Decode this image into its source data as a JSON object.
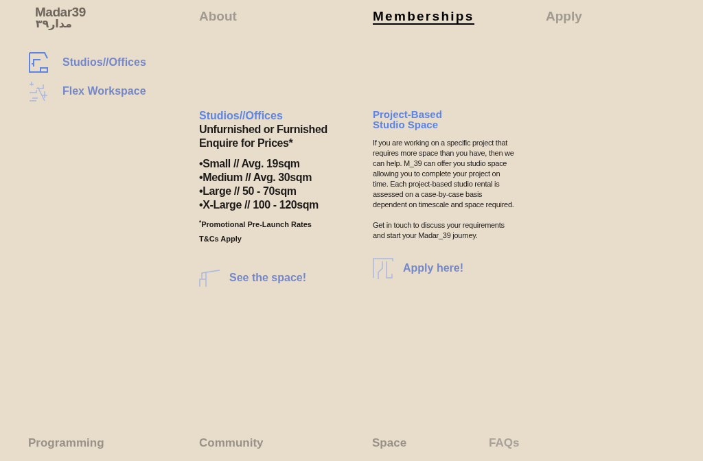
{
  "logo": {
    "latin": "Madar39",
    "arabic": "مدار٣٩"
  },
  "nav": [
    {
      "label": "About",
      "selected": false
    },
    {
      "label": "Memberships",
      "selected": true
    },
    {
      "label": "Apply",
      "selected": false
    }
  ],
  "sidebar": {
    "items": [
      {
        "label": "Studios//Offices",
        "selected": true
      },
      {
        "label": "Flex Workspace",
        "selected": false
      }
    ]
  },
  "studios": {
    "title": "Studios//Offices",
    "subtitle_lines": [
      "Unfurnished or Furnished",
      "Enquire for Prices*"
    ],
    "sizes": [
      "•Small // Avg. 19sqm",
      "•Medium // Avg. 30sqm",
      "•Large // 50 - 70sqm",
      "•X-Large // 100 - 120sqm"
    ],
    "footnote": "$^{*}$Promotional Pre-Launch Rates",
    "terms": "T&Cs Apply",
    "link": "See the space!"
  },
  "project": {
    "title_lines": [
      "Project-Based",
      "Studio Space"
    ],
    "paragraphs": [
      "If you are working on a specific project that requires more space than you have, then we can help. M_39 can offer you studio space allowing you to complete your project on time. Each project-based studio rental is assessed on a case-by-case basis dependent on timescale and space required.",
      "Get in touch to discuss your requirements and start your Madar_39 journey."
    ],
    "link": "Apply here!"
  },
  "footer": [
    "Programming",
    "Community",
    "Space",
    "FAQs"
  ]
}
